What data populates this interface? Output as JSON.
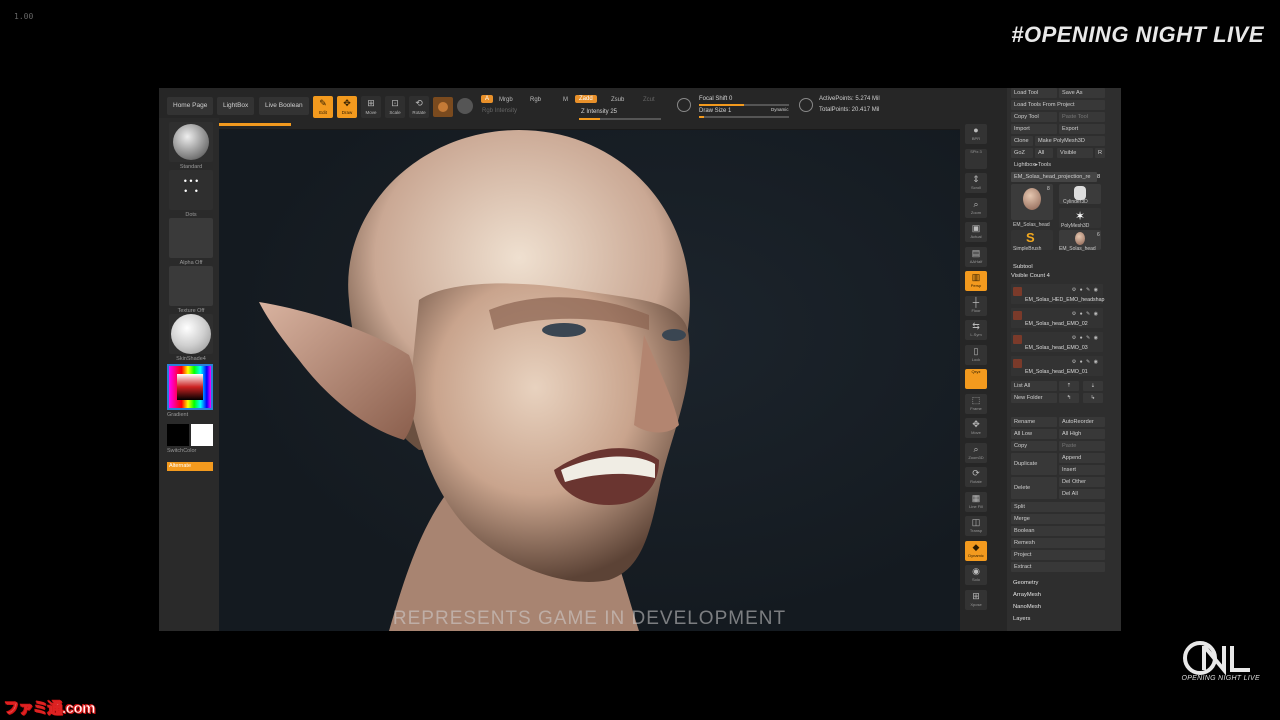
{
  "overlay": {
    "version": "1.00",
    "event_tag": "#OPENING NIGHT LIVE",
    "logo_text": "OPENING NIGHT LIVE",
    "watermark": "ファミ通.com",
    "disclaimer": "REPRESENTS GAME IN DEVELOPMENT"
  },
  "shelf": {
    "home_page": "Home Page",
    "lightbox": "LightBox",
    "live_boolean": "Live Boolean",
    "tools": [
      {
        "label": "Edit",
        "icon": "edit-icon",
        "active": true
      },
      {
        "label": "Draw",
        "icon": "draw-icon",
        "active": true
      },
      {
        "label": "Move",
        "icon": "move-icon",
        "active": false
      },
      {
        "label": "Scale",
        "icon": "scale-icon",
        "active": false
      },
      {
        "label": "Rotate",
        "icon": "rotate-icon",
        "active": false
      }
    ],
    "modes": {
      "a": "A",
      "mrgb": "Mrgb",
      "rgb": "Rgb",
      "m": "M",
      "zadd": "Zadd",
      "zsub": "Zsub",
      "zcut": "Zcut"
    },
    "rgb_intensity": "Rgb Intensity",
    "z_intensity": "Z Intensity 25",
    "focal_shift": "Focal Shift 0",
    "draw_size": "Draw Size 1",
    "dynamic": "Dynamic",
    "active_points": "ActivePoints: 5.274 Mil",
    "total_points": "TotalPoints: 20.417 Mil",
    "z_intensity_level": 0.25,
    "focal_shift_level": 0.5,
    "draw_size_level": 0.05
  },
  "left_tray": {
    "brush": "Standard",
    "stroke": "Dots",
    "alpha": "Alpha Off",
    "texture": "Texture Off",
    "material": "SkinShade4",
    "gradient": "Gradient",
    "switch_color": "SwitchColor",
    "alternate": "Alternate"
  },
  "right_tray": {
    "items": [
      {
        "label": "BPR",
        "glyph": "●",
        "on": false
      },
      {
        "label": "SPix 3",
        "glyph": "",
        "on": false
      },
      {
        "label": "Scroll",
        "glyph": "⇕",
        "on": false
      },
      {
        "label": "Zoom",
        "glyph": "⌕",
        "on": false
      },
      {
        "label": "Actual",
        "glyph": "▣",
        "on": false
      },
      {
        "label": "AAHalf",
        "glyph": "▤",
        "on": false
      },
      {
        "label": "Persp",
        "glyph": "▥",
        "on": true
      },
      {
        "label": "Floor",
        "glyph": "┼",
        "on": false
      },
      {
        "label": "L.Sym",
        "glyph": "⇆",
        "on": false
      },
      {
        "label": "Lock",
        "glyph": "▯",
        "on": false
      },
      {
        "label": "Qxyz",
        "glyph": "",
        "on": true
      },
      {
        "label": "Frame",
        "glyph": "⬚",
        "on": false
      },
      {
        "label": "Move",
        "glyph": "✥",
        "on": false
      },
      {
        "label": "Zoom3D",
        "glyph": "⌕",
        "on": false
      },
      {
        "label": "Rotate",
        "glyph": "⟳",
        "on": false
      },
      {
        "label": "Line Fill",
        "glyph": "▦",
        "on": false
      },
      {
        "label": "Transp",
        "glyph": "◫",
        "on": false
      },
      {
        "label": "Dynamic",
        "glyph": "◆",
        "on": true
      },
      {
        "label": "Solo",
        "glyph": "◉",
        "on": false
      },
      {
        "label": "Xpose",
        "glyph": "⊞",
        "on": false
      }
    ]
  },
  "palette": {
    "load_tool": "Load Tool",
    "save_as": "Save As",
    "load_from_project": "Load Tools From Project",
    "copy_tool": "Copy Tool",
    "paste_tool": "Paste Tool",
    "import": "Import",
    "export": "Export",
    "clone": "Clone",
    "make_polymesh": "Make PolyMesh3D",
    "goz": "GoZ",
    "all": "All",
    "visible": "Visible",
    "r": "R",
    "lightbox_tools": "Lightbox▸Tools",
    "current_tool": "EM_Solas_head_projection_re",
    "current_tool_count": "8",
    "thumbs": [
      {
        "label": "EM_Solas_head",
        "count": "8"
      },
      {
        "label": "Cylinder3D",
        "count": ""
      },
      {
        "label": "PolyMesh3D",
        "count": ""
      },
      {
        "label": "SimpleBrush",
        "count": ""
      },
      {
        "label": "EM_Solas_head",
        "count": "6"
      }
    ],
    "subtool": "Subtool",
    "visible_count": "Visible Count 4",
    "subtools": [
      "EM_Solas_HED_EMO_headshap",
      "EM_Solas_head_EMO_02",
      "EM_Solas_head_EMO_03",
      "EM_Solas_head_EMO_01"
    ],
    "list_all": "List All",
    "new_folder": "New Folder",
    "rename": "Rename",
    "auto_reorder": "AutoReorder",
    "all_low": "All Low",
    "all_high": "All High",
    "copy": "Copy",
    "paste": "Paste",
    "duplicate": "Duplicate",
    "append": "Append",
    "insert": "Insert",
    "delete": "Delete",
    "del_other": "Del Other",
    "del_all": "Del All",
    "split": "Split",
    "merge": "Merge",
    "boolean": "Boolean",
    "remesh": "Remesh",
    "project": "Project",
    "extract": "Extract",
    "sections": [
      "Geometry",
      "ArrayMesh",
      "NanoMesh",
      "Layers"
    ]
  },
  "colors": {
    "accent": "#f39a1e",
    "panel": "#2b2b2b",
    "viewport": "#141a20"
  }
}
